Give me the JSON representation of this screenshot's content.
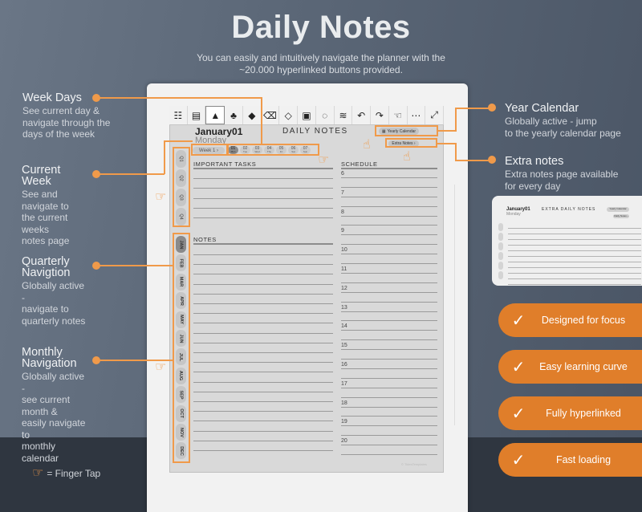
{
  "header": {
    "title": "Daily Notes",
    "subtitle_line1": "You can easily and intuitively navigate the planner with the",
    "subtitle_line2": "~20.000 hyperlinked buttons provided."
  },
  "annotations_left": [
    {
      "title": "Week Days",
      "desc": [
        "See current day &",
        "navigate through the",
        "days of the week"
      ]
    },
    {
      "title": "Current Week",
      "desc": [
        "See and navigate to",
        "the current weeks",
        "notes page"
      ]
    },
    {
      "title": "Quarterly Navigtion",
      "desc": [
        "Globally active -",
        "navigate to",
        "quarterly notes"
      ]
    },
    {
      "title": "Monthly Navigation",
      "desc": [
        "Globally active -",
        "see current month &",
        "easily navigate to",
        "monthly calendar"
      ]
    }
  ],
  "annotations_right": [
    {
      "title": "Year Calendar",
      "desc": [
        "Globally active - jump",
        "to the yearly calendar page"
      ]
    },
    {
      "title": "Extra notes",
      "desc": [
        "Extra notes page available",
        "for every day"
      ]
    }
  ],
  "planner": {
    "toolbar_icons": [
      "toc-icon",
      "page-list-icon",
      "pen-icon",
      "brush-icon",
      "highlighter-icon",
      "eraser-icon",
      "selection-eraser-icon",
      "screenshot-icon",
      "lasso-icon",
      "layers-icon",
      "undo-icon",
      "redo-icon",
      "gesture-icon",
      "more-icon",
      "fullscreen-icon"
    ],
    "date": "January01",
    "weekday": "Monday",
    "page_title": "DAILY NOTES",
    "yearly_calendar_label": "Yearly Calendar",
    "extra_notes_label": "Extra Notes ›",
    "week_label": "Week 1  ›",
    "days": [
      {
        "num": "01",
        "abbr": "Mon"
      },
      {
        "num": "02",
        "abbr": "Tue"
      },
      {
        "num": "03",
        "abbr": "Wed"
      },
      {
        "num": "04",
        "abbr": "Thu"
      },
      {
        "num": "05",
        "abbr": "Fri"
      },
      {
        "num": "06",
        "abbr": "Sat"
      },
      {
        "num": "07",
        "abbr": "Sun"
      }
    ],
    "current_day_index": 0,
    "important_tasks_label": "IMPORTANT TASKS",
    "notes_label": "NOTES",
    "schedule_label": "SCHEDULE",
    "hours": [
      "6",
      "7",
      "8",
      "9",
      "10",
      "11",
      "12",
      "13",
      "14",
      "15",
      "16",
      "17",
      "18",
      "19",
      "20"
    ],
    "quarters": [
      "Q1",
      "Q2",
      "Q3",
      "Q4"
    ],
    "months": [
      "JAN",
      "FEB",
      "MAR",
      "APR",
      "MAY",
      "JUN",
      "JUL",
      "AUG",
      "SEP",
      "OCT",
      "NOV",
      "DEC"
    ],
    "current_month_index": 0,
    "watermark": "© TidesTemplates"
  },
  "mini_page": {
    "date": "January01",
    "weekday": "Monday",
    "title": "EXTRA DAILY NOTES",
    "yearly_calendar_label": "Yearly Calendar",
    "daily_notes_label": "Daily Notes ›",
    "quarters": [
      "Q1",
      "Q2",
      "Q3",
      "Q4"
    ],
    "months": [
      "JAN",
      "FEB"
    ]
  },
  "features": [
    {
      "label": "Designed for focus",
      "icon": "check-icon"
    },
    {
      "label": "Easy learning curve",
      "icon": "check-icon"
    },
    {
      "label": "Fully hyperlinked",
      "icon": "check-icon"
    },
    {
      "label": "Fast loading",
      "icon": "check-icon"
    }
  ],
  "legend": {
    "icon": "finger-tap-icon",
    "label": "= Finger Tap"
  },
  "colors": {
    "accent": "#f09a4a",
    "pill": "#e07e2a",
    "background": "#5b6777",
    "band": "#2f3640"
  }
}
